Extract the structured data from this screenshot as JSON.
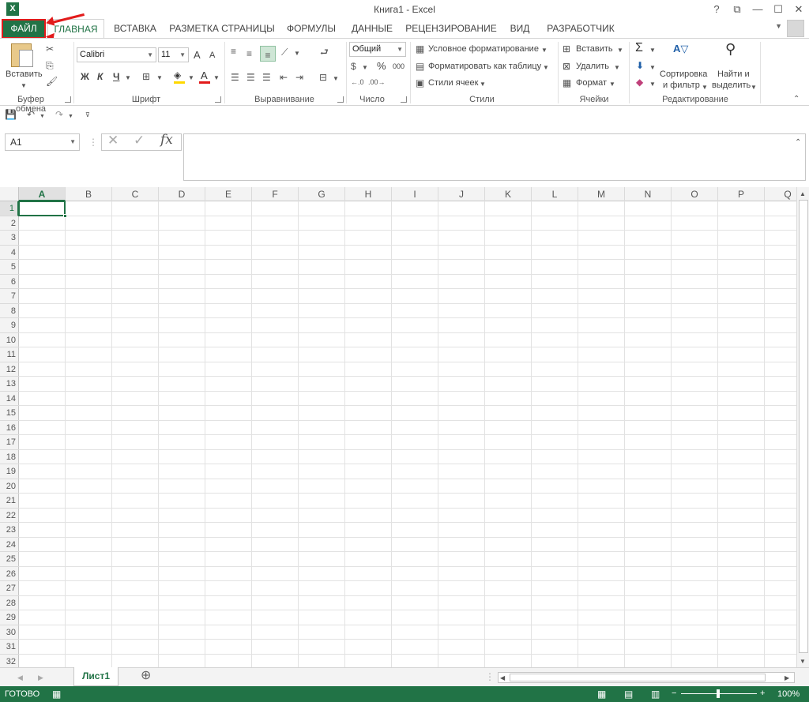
{
  "window": {
    "title": "Книга1 - Excel",
    "help": "?",
    "ribbon_display": "⧉",
    "minimize": "—",
    "maximize": "☐",
    "close": "✕"
  },
  "tabs": {
    "file": "ФАЙЛ",
    "items": [
      "ГЛАВНАЯ",
      "ВСТАВКА",
      "РАЗМЕТКА СТРАНИЦЫ",
      "ФОРМУЛЫ",
      "ДАННЫЕ",
      "РЕЦЕНЗИРОВАНИЕ",
      "ВИД",
      "РАЗРАБОТЧИК"
    ],
    "active": "ГЛАВНАЯ"
  },
  "ribbon": {
    "clipboard": {
      "label": "Буфер обмена",
      "paste": "Вставить"
    },
    "font": {
      "label": "Шрифт",
      "name": "Calibri",
      "size": "11",
      "grow": "A",
      "shrink": "A",
      "bold": "Ж",
      "italic": "К",
      "underline": "Ч",
      "font_color": "A"
    },
    "alignment": {
      "label": "Выравнивание"
    },
    "number": {
      "label": "Число",
      "format": "Общий",
      "percent": "%",
      "thousands": "000"
    },
    "styles": {
      "label": "Стили",
      "conditional": "Условное форматирование",
      "as_table": "Форматировать как таблицу",
      "cell_styles": "Стили ячеек"
    },
    "cells": {
      "label": "Ячейки",
      "insert": "Вставить",
      "delete": "Удалить",
      "format": "Формат"
    },
    "editing": {
      "label": "Редактирование",
      "autosum": "Σ",
      "sort_line1": "Сортировка",
      "sort_line2": "и фильтр",
      "find_line1": "Найти и",
      "find_line2": "выделить"
    }
  },
  "qat": {
    "save": "💾",
    "undo": "↶",
    "redo": "↷"
  },
  "formula_bar": {
    "name_box": "A1",
    "cancel": "✕",
    "enter": "✓",
    "fx": "fx",
    "value": ""
  },
  "grid": {
    "columns": [
      "A",
      "B",
      "C",
      "D",
      "E",
      "F",
      "G",
      "H",
      "I",
      "J",
      "K",
      "L",
      "M",
      "N",
      "O",
      "P",
      "Q"
    ],
    "rows": [
      "1",
      "2",
      "3",
      "4",
      "5",
      "6",
      "7",
      "8",
      "9",
      "10",
      "11",
      "12",
      "13",
      "14",
      "15",
      "16",
      "17",
      "18",
      "19",
      "20",
      "21",
      "22",
      "23",
      "24",
      "25",
      "26",
      "27",
      "28",
      "29",
      "30",
      "31",
      "32"
    ],
    "selected_cell": "A1"
  },
  "sheets": {
    "tabs": [
      "Лист1"
    ],
    "add": "⊕"
  },
  "status": {
    "text": "ГОТОВО",
    "zoom": "100%",
    "zoom_out": "−",
    "zoom_in": "+"
  },
  "colors": {
    "brand": "#217346",
    "highlight": "#e21b1b"
  }
}
